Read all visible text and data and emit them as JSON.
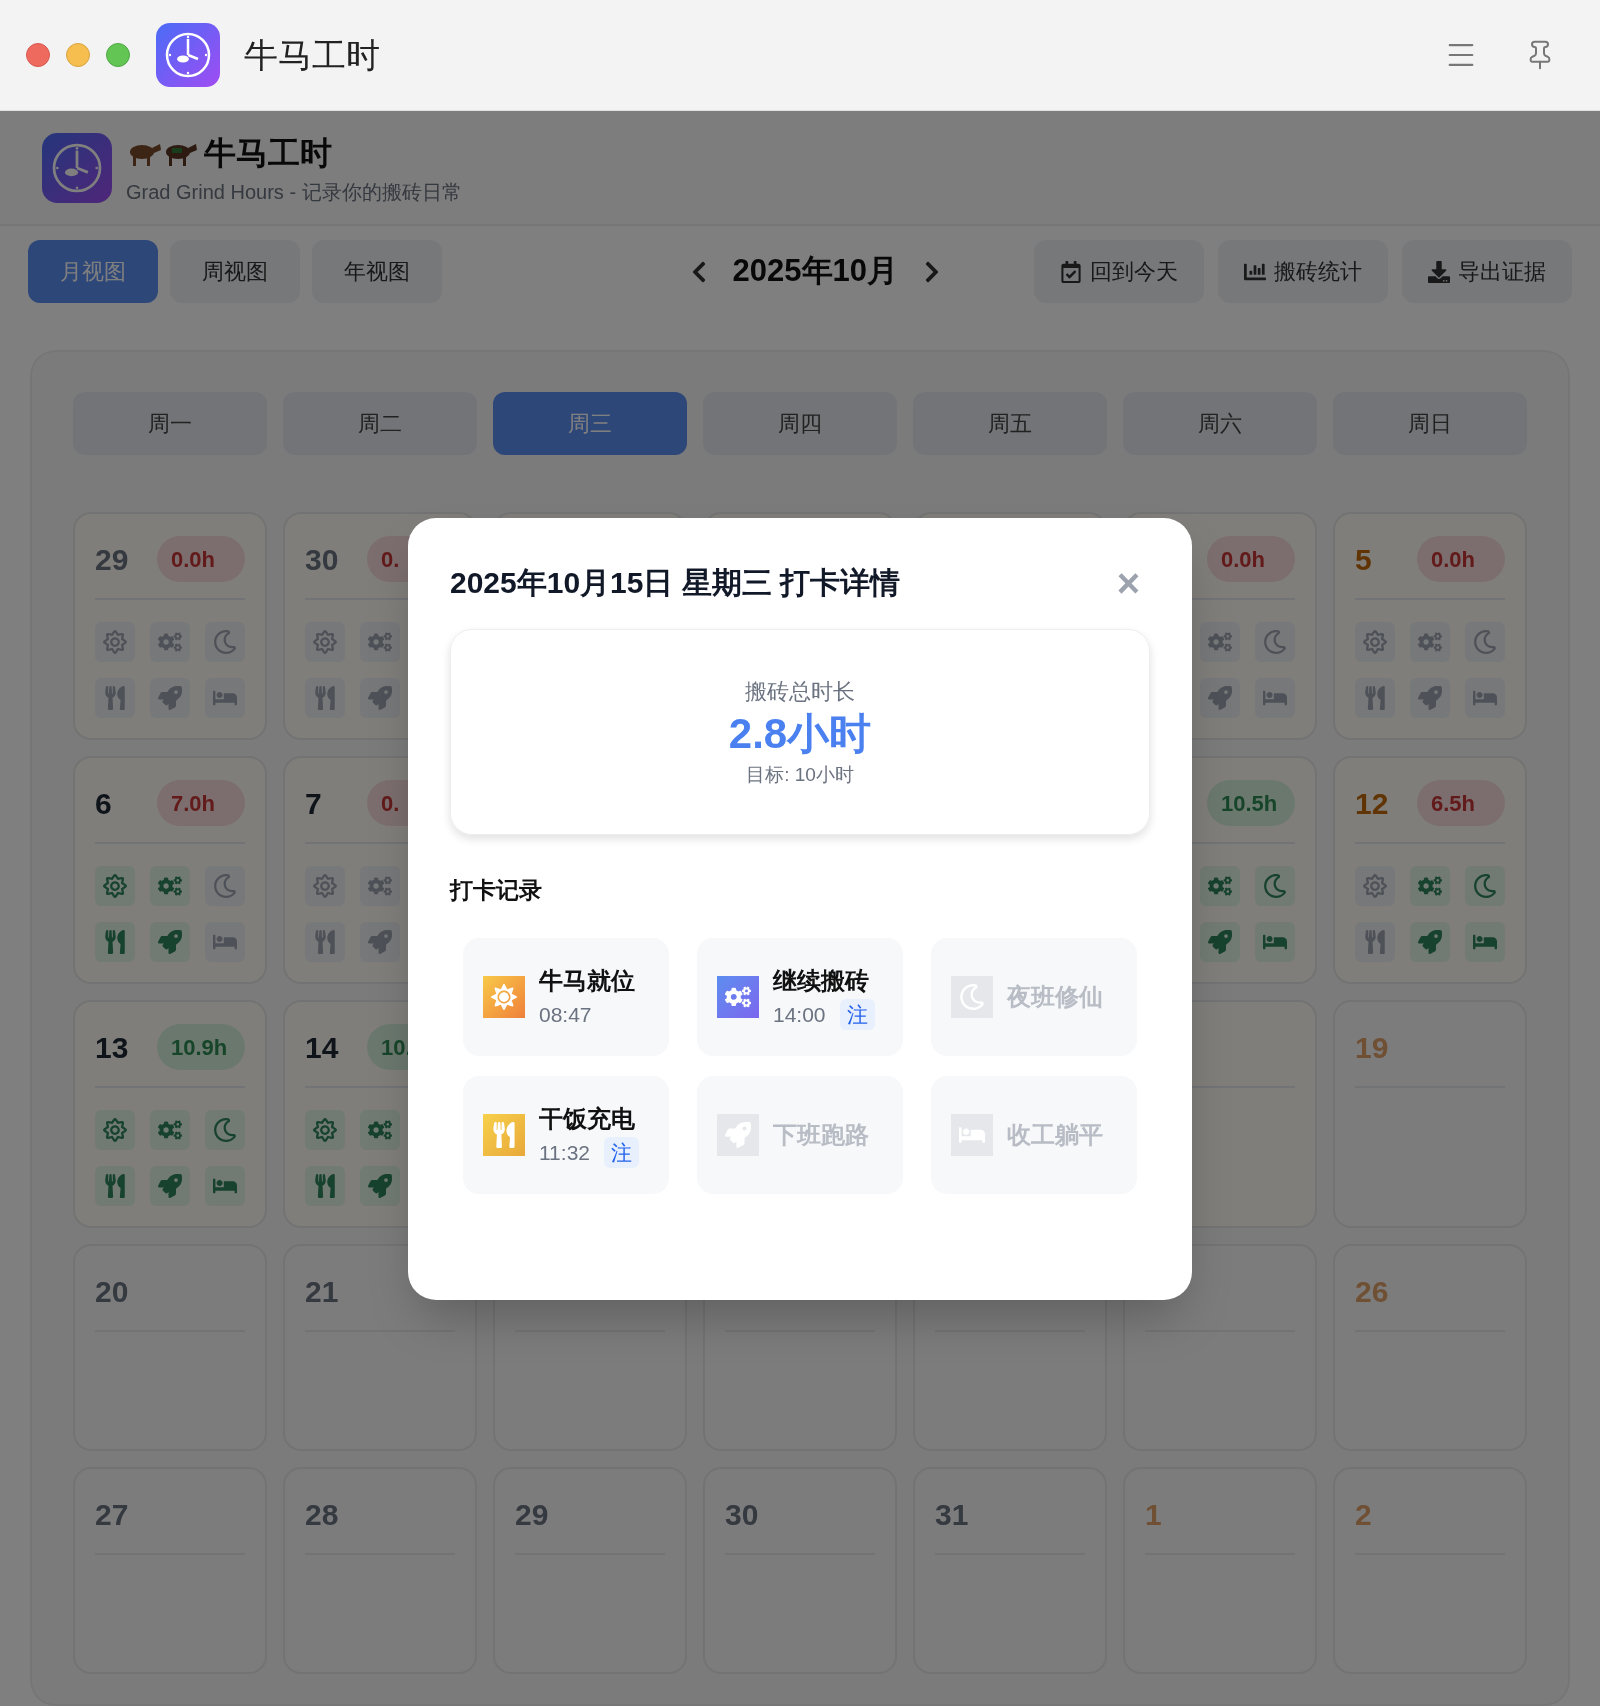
{
  "window": {
    "title": "牛马工时"
  },
  "header": {
    "title": "牛马工时",
    "subtitle": "Grad Grind Hours - 记录你的搬砖日常"
  },
  "toolbar": {
    "view_tabs": [
      {
        "label": "月视图",
        "selected": true
      },
      {
        "label": "周视图",
        "selected": false
      },
      {
        "label": "年视图",
        "selected": false
      }
    ],
    "month": "2025年10月",
    "actions": [
      {
        "kind": "today",
        "label": "回到今天"
      },
      {
        "kind": "stats",
        "label": "搬砖统计"
      },
      {
        "kind": "export",
        "label": "导出证据"
      }
    ]
  },
  "calendar": {
    "weekdays": [
      {
        "label": "周一",
        "selected": false
      },
      {
        "label": "周二",
        "selected": false
      },
      {
        "label": "周三",
        "selected": true
      },
      {
        "label": "周四",
        "selected": false
      },
      {
        "label": "周五",
        "selected": false
      },
      {
        "label": "周六",
        "selected": false
      },
      {
        "label": "周日",
        "selected": false
      }
    ],
    "rows": [
      [
        {
          "day": "29",
          "kind": "muted",
          "hours": "0.0h",
          "met": false,
          "icons": [
            {
              "kind": "sun",
              "on": false
            },
            {
              "kind": "gears",
              "on": false
            },
            {
              "kind": "moon",
              "on": false
            },
            {
              "kind": "fork",
              "on": false
            },
            {
              "kind": "rocket",
              "on": false
            },
            {
              "kind": "bed",
              "on": false
            }
          ]
        },
        {
          "day": "30",
          "kind": "muted",
          "hours": "0.",
          "met": false,
          "icons": [
            {
              "kind": "sun",
              "on": false
            },
            {
              "kind": "gears",
              "on": false
            },
            {
              "kind": "fork",
              "on": false
            },
            {
              "kind": "rocket",
              "on": false
            }
          ]
        },
        {
          "kind": "normal"
        },
        {
          "kind": "normal"
        },
        {
          "kind": "normal"
        },
        {
          "kind": "normal",
          "hours": "0.0h",
          "met": false,
          "icons": [
            {
              "kind": "gears",
              "on": false
            },
            {
              "kind": "moon",
              "on": false
            },
            {
              "kind": "rocket",
              "on": false
            },
            {
              "kind": "bed",
              "on": false
            }
          ]
        },
        {
          "day": "5",
          "kind": "weekend",
          "hours": "0.0h",
          "met": false,
          "icons": [
            {
              "kind": "sun",
              "on": false
            },
            {
              "kind": "gears",
              "on": false
            },
            {
              "kind": "moon",
              "on": false
            },
            {
              "kind": "fork",
              "on": false
            },
            {
              "kind": "rocket",
              "on": false
            },
            {
              "kind": "bed",
              "on": false
            }
          ]
        }
      ],
      [
        {
          "day": "6",
          "kind": "normal",
          "hours": "7.0h",
          "met": false,
          "icons": [
            {
              "kind": "sun",
              "on": true
            },
            {
              "kind": "gears",
              "on": true
            },
            {
              "kind": "moon",
              "on": false
            },
            {
              "kind": "fork",
              "on": true
            },
            {
              "kind": "rocket",
              "on": true
            },
            {
              "kind": "bed",
              "on": false
            }
          ]
        },
        {
          "day": "7",
          "kind": "normal",
          "hours": "0.",
          "met": false,
          "icons": [
            {
              "kind": "sun",
              "on": false
            },
            {
              "kind": "gears",
              "on": false
            },
            {
              "kind": "fork",
              "on": false
            },
            {
              "kind": "rocket",
              "on": false
            }
          ]
        },
        {
          "kind": "covered"
        },
        {
          "kind": "covered"
        },
        {
          "kind": "covered"
        },
        {
          "kind": "normal",
          "hours": "10.5h",
          "met": true,
          "icons": [
            {
              "kind": "gears",
              "on": true
            },
            {
              "kind": "moon",
              "on": true
            },
            {
              "kind": "rocket",
              "on": true
            },
            {
              "kind": "bed",
              "on": true
            }
          ]
        },
        {
          "day": "12",
          "kind": "weekend",
          "hours": "6.5h",
          "met": false,
          "icons": [
            {
              "kind": "sun",
              "on": false
            },
            {
              "kind": "gears",
              "on": true
            },
            {
              "kind": "moon",
              "on": true
            },
            {
              "kind": "fork",
              "on": false
            },
            {
              "kind": "rocket",
              "on": true
            },
            {
              "kind": "bed",
              "on": true
            }
          ]
        }
      ],
      [
        {
          "day": "13",
          "kind": "normal",
          "hours": "10.9h",
          "met": true,
          "icons": [
            {
              "kind": "sun",
              "on": true
            },
            {
              "kind": "gears",
              "on": true
            },
            {
              "kind": "moon",
              "on": true
            },
            {
              "kind": "fork",
              "on": true
            },
            {
              "kind": "rocket",
              "on": true
            },
            {
              "kind": "bed",
              "on": true
            }
          ]
        },
        {
          "day": "14",
          "kind": "normal",
          "hours": "10.",
          "met": true,
          "icons": [
            {
              "kind": "sun",
              "on": true
            },
            {
              "kind": "gears",
              "on": true
            },
            {
              "kind": "fork",
              "on": true
            },
            {
              "kind": "rocket",
              "on": true
            }
          ]
        },
        {
          "kind": "covered"
        },
        {
          "kind": "covered"
        },
        {
          "kind": "covered"
        },
        {
          "kind": "normal"
        },
        {
          "day": "19",
          "kind": "future_weekend"
        }
      ],
      [
        {
          "day": "20",
          "kind": "future"
        },
        {
          "day": "21",
          "kind": "future"
        },
        {
          "kind": "future"
        },
        {
          "kind": "future"
        },
        {
          "kind": "future"
        },
        {
          "kind": "future_weekend"
        },
        {
          "day": "26",
          "kind": "future_weekend"
        }
      ],
      [
        {
          "day": "27",
          "kind": "future"
        },
        {
          "day": "28",
          "kind": "future"
        },
        {
          "day": "29",
          "kind": "future"
        },
        {
          "day": "30",
          "kind": "future"
        },
        {
          "day": "31",
          "kind": "future"
        },
        {
          "day": "1",
          "kind": "future_weekend"
        },
        {
          "day": "2",
          "kind": "future_weekend"
        }
      ]
    ]
  },
  "modal": {
    "title": "2025年10月15日 星期三 打卡详情",
    "close": "×",
    "summary": {
      "label": "搬砖总时长",
      "value": "2.8小时",
      "target": "目标: 10小时"
    },
    "records_title": "打卡记录",
    "records": [
      {
        "kind": "sun",
        "label": "牛马就位",
        "time": "08:47",
        "done": true
      },
      {
        "kind": "gears",
        "label": "继续搬砖",
        "time": "14:00",
        "note": "注",
        "done": true
      },
      {
        "kind": "moon",
        "label": "夜班修仙",
        "done": false
      },
      {
        "kind": "fork",
        "label": "干饭充电",
        "time": "11:32",
        "note": "注",
        "done": true
      },
      {
        "kind": "rocket",
        "label": "下班跑路",
        "done": false
      },
      {
        "kind": "bed",
        "label": "收工躺平",
        "done": false
      }
    ]
  }
}
